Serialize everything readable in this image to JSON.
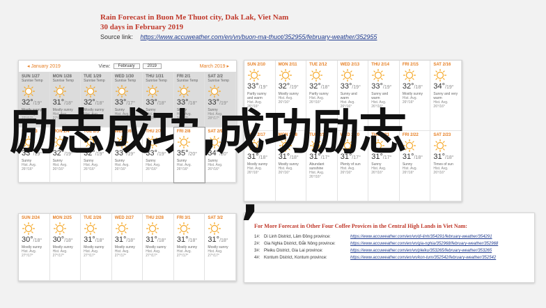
{
  "header": {
    "title": "Rain Forecast in Buon Me Thuot city, Dak Lak, Viet Nam",
    "subtitle": "30 days in February 2019",
    "source_label": "Source link:",
    "source_url": "https://www.accuweather.com/en/vn/buon-ma-thuot/352955/february-weather/352955"
  },
  "calendar_nav": {
    "prev_month": "◂ January 2019",
    "view_label": "View:",
    "month_select": "February",
    "year_select": "2019",
    "next_month": "March 2019 ▸"
  },
  "panel_a": [
    {
      "day": "SUN 1/27",
      "hl": "Sunrise Temp",
      "temp": "32°",
      "lo": "/19°",
      "cond": "Mostly sunny",
      "hist": "Hist. Avg. 27°/17°",
      "past": true
    },
    {
      "day": "MON 1/28",
      "hl": "Sunrise Temp",
      "temp": "31°",
      "lo": "/18°",
      "cond": "Mostly sunny",
      "hist": "Hist. Avg. 27°/17°",
      "past": true
    },
    {
      "day": "TUE 1/29",
      "hl": "Sunrise Temp",
      "temp": "32°",
      "lo": "/18°",
      "cond": "Mostly sunny",
      "hist": "Hist. Avg. 27°/17°",
      "past": true
    },
    {
      "day": "WED 1/30",
      "hl": "Sunrise Temp",
      "temp": "33°",
      "lo": "/17°",
      "cond": "Sunny",
      "hist": "Hist. Avg. 28°/17°",
      "past": true
    },
    {
      "day": "THU 1/31",
      "hl": "Sunrise Temp",
      "temp": "33°",
      "lo": "/18°",
      "cond": "Sunny",
      "hist": "Hist. Avg. 28°/17°",
      "past": true
    },
    {
      "day": "FRI 2/1",
      "hl": "Sunrise Temp",
      "temp": "33°",
      "lo": "/18°",
      "cond": "Sunny",
      "hist": "Hist. Avg. 28°/17°",
      "past": true
    },
    {
      "day": "SAT 2/2",
      "hl": "Sunrise Temp",
      "temp": "33°",
      "lo": "/19°",
      "cond": "Sunny",
      "hist": "Hist. Avg. 28°/17°",
      "past": true
    },
    {
      "day": "SUN 2/3",
      "hl": "",
      "temp": "33°",
      "lo": "/19°",
      "cond": "Sunny",
      "hist": "Hist. Avg. 26°/16°",
      "past": false
    },
    {
      "day": "MON 2/4",
      "hl": "",
      "temp": "32°",
      "lo": "/19°",
      "cond": "Sunny",
      "hist": "Hist. Avg. 26°/16°",
      "past": false
    },
    {
      "day": "TUE 2/5",
      "hl": "",
      "temp": "32°",
      "lo": "/19°",
      "cond": "Sunny",
      "hist": "Hist. Avg. 26°/16°",
      "past": false
    },
    {
      "day": "WED 2/6",
      "hl": "",
      "temp": "33°",
      "lo": "/19°",
      "cond": "Sunny",
      "hist": "Hist. Avg. 26°/16°",
      "past": false
    },
    {
      "day": "THU 2/7",
      "hl": "",
      "temp": "33°",
      "lo": "/19°",
      "cond": "Sunny",
      "hist": "Hist. Avg. 26°/16°",
      "past": false
    },
    {
      "day": "FRI 2/8",
      "hl": "",
      "temp": "35°",
      "lo": "/20°",
      "cond": "Sunny",
      "hist": "Hist. Avg. 26°/16°",
      "past": false,
      "today": true
    },
    {
      "day": "SAT 2/9",
      "hl": "",
      "temp": "34°",
      "lo": "/20°",
      "cond": "Sunny",
      "hist": "Hist. Avg. 26°/16°",
      "past": false
    }
  ],
  "panel_b": [
    {
      "day": "SUN 2/10",
      "temp": "33°",
      "lo": "/19°",
      "cond": "Partly sunny and warm",
      "hist": "Hist. Avg. 26°/16°"
    },
    {
      "day": "MON 2/11",
      "temp": "32°",
      "lo": "/19°",
      "cond": "Mostly sunny",
      "hist": "Hist. Avg. 26°/16°"
    },
    {
      "day": "TUE 2/12",
      "temp": "32°",
      "lo": "/18°",
      "cond": "Partly sunny",
      "hist": "Hist. Avg. 26°/16°"
    },
    {
      "day": "WED 2/13",
      "temp": "33°",
      "lo": "/19°",
      "cond": "Sunny and warm",
      "hist": "Hist. Avg. 26°/16°"
    },
    {
      "day": "THU 2/14",
      "temp": "33°",
      "lo": "/19°",
      "cond": "Sunny and warm",
      "hist": "Hist. Avg. 26°/16°"
    },
    {
      "day": "FRI 2/15",
      "temp": "32°",
      "lo": "/18°",
      "cond": "Mostly sunny",
      "hist": "Hist. Avg. 26°/16°"
    },
    {
      "day": "SAT 2/16",
      "temp": "34°",
      "lo": "/19°",
      "cond": "Sunny and very warm",
      "hist": "Hist. Avg. 26°/16°"
    },
    {
      "day": "SUN 2/17",
      "temp": "31°",
      "lo": "/18°",
      "cond": "Mostly sunny",
      "hist": "Hist. Avg. 26°/16°"
    },
    {
      "day": "MON 2/18",
      "temp": "31°",
      "lo": "/18°",
      "cond": "Mostly sunny",
      "hist": "Hist. Avg. 26°/16°"
    },
    {
      "day": "TUE 2/19",
      "temp": "31°",
      "lo": "/17°",
      "cond": "Abundant sunshine",
      "hist": "Hist. Avg. 26°/16°"
    },
    {
      "day": "WED 2/20",
      "temp": "31°",
      "lo": "/17°",
      "cond": "Plenty of sun",
      "hist": "Hist. Avg. 26°/16°"
    },
    {
      "day": "THU 2/21",
      "temp": "31°",
      "lo": "/17°",
      "cond": "Sunny",
      "hist": "Hist. Avg. 26°/16°"
    },
    {
      "day": "FRI 2/22",
      "temp": "31°",
      "lo": "/18°",
      "cond": "Sunny",
      "hist": "Hist. Avg. 26°/16°"
    },
    {
      "day": "SAT 2/23",
      "temp": "31°",
      "lo": "/18°",
      "cond": "Times of sun",
      "hist": "Hist. Avg. 26°/16°"
    }
  ],
  "panel_c": [
    {
      "day": "SUN 2/24",
      "temp": "30°",
      "lo": "/18°",
      "cond": "Mostly sunny",
      "hist": "Hist. Avg. 27°/17°"
    },
    {
      "day": "MON 2/25",
      "temp": "30°",
      "lo": "/18°",
      "cond": "Mostly sunny",
      "hist": "Hist. Avg. 27°/17°"
    },
    {
      "day": "TUE 2/26",
      "temp": "31°",
      "lo": "/18°",
      "cond": "Mostly sunny",
      "hist": "Hist. Avg. 27°/17°"
    },
    {
      "day": "WED 2/27",
      "temp": "31°",
      "lo": "/18°",
      "cond": "Mostly sunny",
      "hist": "Hist. Avg. 27°/17°"
    },
    {
      "day": "THU 2/28",
      "temp": "31°",
      "lo": "/18°",
      "cond": "Mostly sunny",
      "hist": "Hist. Avg. 27°/17°"
    },
    {
      "day": "FRI 3/1",
      "temp": "31°",
      "lo": "/18°",
      "cond": "Mostly sunny",
      "hist": "Hist. Avg. 27°/17°"
    },
    {
      "day": "SAT 3/2",
      "temp": "31°",
      "lo": "/18°",
      "cond": "Mostly sunny",
      "hist": "Hist. Avg. 27°/17°"
    }
  ],
  "overlay": {
    "text": "励志成功,成功励志",
    "comma": ","
  },
  "more": {
    "title": "For More Forecast in Other Four Coffee Provices in the Central High Lands in Viet Nam:",
    "items": [
      {
        "n": "1#:",
        "place": "Di Linh District, Lâm Đồng province:",
        "url": "https://www.accuweather.com/en/vn/di-linh/354291/february-weather/354291"
      },
      {
        "n": "2#:",
        "place": "Gia Nghia District, Đắk Nông province:",
        "url": "https://www.accuweather.com/en/vn/gia-nghia/352968/february-weather/352968"
      },
      {
        "n": "3#:",
        "place": "Pleiku District, Gia Lai province:",
        "url": "https://www.accuweather.com/en/vn/pleiku/353265/february-weather/353265"
      },
      {
        "n": "4#:",
        "place": "Kontum District, Kontum province:",
        "url": "https://www.accuweather.com/en/vn/kon-tum/352542/february-weather/352542"
      }
    ]
  },
  "colors": {
    "accent": "#e67e22",
    "title_red": "#c0392b",
    "link_blue": "#1f3b8f",
    "sun": "#f5a623"
  }
}
